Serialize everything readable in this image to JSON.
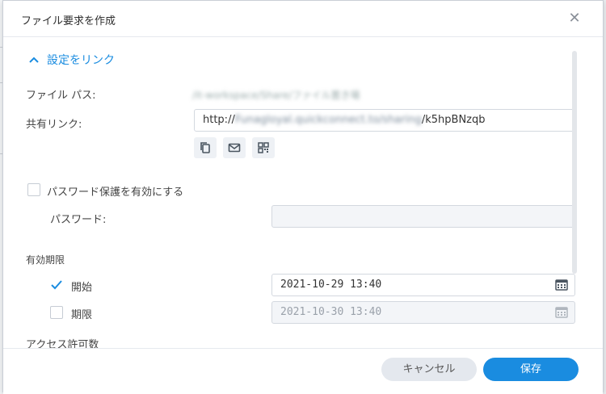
{
  "dialog": {
    "title": "ファイル要求を作成",
    "close_icon": "close-icon"
  },
  "section": {
    "label": "設定をリンク",
    "icon": "chevron-up-icon"
  },
  "file_path": {
    "label": "ファイル パス:",
    "value": "/it-workspace/Share/ファイル置き場"
  },
  "share_link": {
    "label": "共有リンク:",
    "prefix": "http://",
    "host": "Funagloyal.quickconnect.to/sharing",
    "suffix": "/k5hpBNzqb"
  },
  "share_actions": [
    {
      "name": "copy-icon"
    },
    {
      "name": "mail-icon"
    },
    {
      "name": "qr-code-icon"
    }
  ],
  "password": {
    "enable_label": "パスワード保護を有効にする",
    "enable_checked": false,
    "label": "パスワード:",
    "value": ""
  },
  "expiry": {
    "heading": "有効期限",
    "start_label": "開始",
    "start_checked": true,
    "start_value": "2021-10-29 13:40",
    "end_label": "期限",
    "end_checked": false,
    "end_value": "2021-10-30 13:40"
  },
  "access": {
    "heading": "アクセス許可数"
  },
  "footer": {
    "cancel_label": "キャンセル",
    "save_label": "保存"
  },
  "colors": {
    "accent": "#1a8ce0",
    "disabled_bg": "#f3f5f8"
  }
}
